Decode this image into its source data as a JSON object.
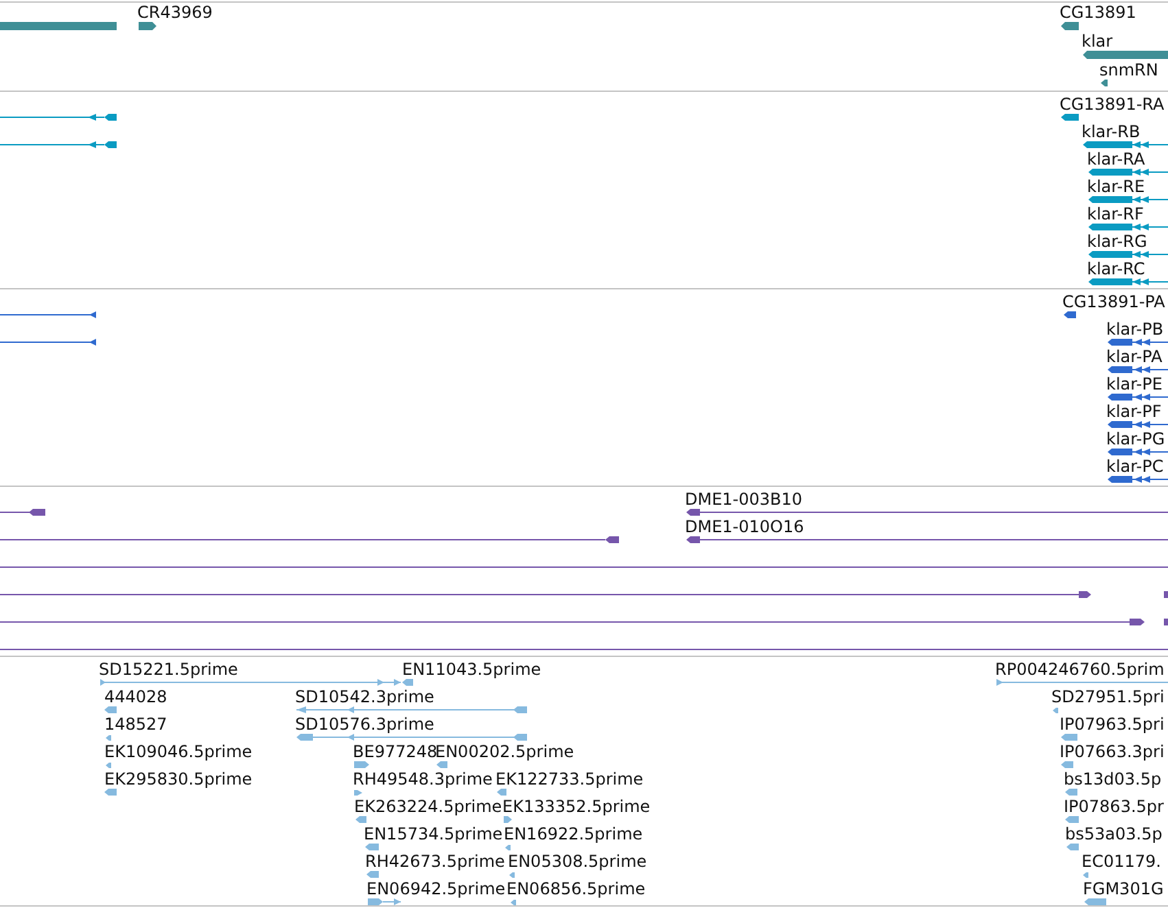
{
  "tracks": [
    {
      "color": "#3f8f96",
      "features": [
        {
          "kind": "block"
        },
        {
          "kind": "block",
          "label": "CR43969",
          "reverse": false
        },
        {
          "kind": "block",
          "label": "CG13891",
          "reverse": true
        },
        {
          "kind": "block",
          "label": "klar",
          "reverse": true
        },
        {
          "kind": "block",
          "label": "snmRN",
          "reverse": true
        }
      ]
    },
    {
      "color": "#0a9bc2",
      "features": [
        {
          "kind": "gapped",
          "reverse": true
        },
        {
          "kind": "block",
          "label": "CG13891-RA",
          "reverse": true
        },
        {
          "kind": "gapped",
          "reverse": true
        },
        {
          "kind": "gapped",
          "label": "klar-RB",
          "reverse": true
        },
        {
          "kind": "gapped",
          "label": "klar-RA",
          "reverse": true
        },
        {
          "kind": "gapped",
          "label": "klar-RE",
          "reverse": true
        },
        {
          "kind": "gapped",
          "label": "klar-RF",
          "reverse": true
        },
        {
          "kind": "gapped",
          "label": "klar-RG",
          "reverse": true
        },
        {
          "kind": "gapped",
          "label": "klar-RC",
          "reverse": true
        }
      ]
    },
    {
      "color": "#2f6acf",
      "features": [
        {
          "kind": "span",
          "reverse": true
        },
        {
          "kind": "block",
          "label": "CG13891-PA",
          "reverse": true
        },
        {
          "kind": "span",
          "reverse": true
        },
        {
          "kind": "gapped",
          "label": "klar-PB",
          "reverse": true
        },
        {
          "kind": "gapped",
          "label": "klar-PA",
          "reverse": true
        },
        {
          "kind": "gapped",
          "label": "klar-PE",
          "reverse": true
        },
        {
          "kind": "gapped",
          "label": "klar-PF",
          "reverse": true
        },
        {
          "kind": "gapped",
          "label": "klar-PG",
          "reverse": true
        },
        {
          "kind": "gapped",
          "label": "klar-PC",
          "reverse": true
        }
      ]
    },
    {
      "color": "#7656ab",
      "features": [
        {
          "kind": "gapped",
          "reverse": true
        },
        {
          "kind": "gapped",
          "label": "DME1-003B10",
          "reverse": true
        },
        {
          "kind": "gapped",
          "reverse": true
        },
        {
          "kind": "gapped",
          "label": "DME1-010O16",
          "reverse": true
        },
        {
          "kind": "span"
        },
        {
          "kind": "gapped",
          "reverse": false
        },
        {
          "kind": "block"
        },
        {
          "kind": "gapped",
          "reverse": false
        },
        {
          "kind": "block"
        },
        {
          "kind": "span"
        }
      ]
    },
    {
      "color": "#86badf",
      "features": [
        {
          "kind": "span",
          "label": "SD15221.5prime",
          "reverse": false
        },
        {
          "kind": "block",
          "label": "EN11043.5prime",
          "reverse": true
        },
        {
          "kind": "span",
          "label": "RP004246760.5prim",
          "reverse": false
        },
        {
          "kind": "block",
          "label": "444028",
          "reverse": true
        },
        {
          "kind": "gapped",
          "label": "SD10542.3prime",
          "reverse": true
        },
        {
          "kind": "block",
          "label": "SD27951.5pri",
          "reverse": true
        },
        {
          "kind": "block",
          "label": "148527",
          "reverse": true
        },
        {
          "kind": "gapped",
          "label": "SD10576.3prime",
          "reverse": true
        },
        {
          "kind": "block",
          "label": "IP07963.5pri",
          "reverse": true
        },
        {
          "kind": "block",
          "label": "EK109046.5prime",
          "reverse": true
        },
        {
          "kind": "block",
          "label": "BE977248",
          "reverse": false
        },
        {
          "kind": "block",
          "label": "EN00202.5prime",
          "reverse": true
        },
        {
          "kind": "block",
          "label": "IP07663.3pri",
          "reverse": true
        },
        {
          "kind": "block",
          "label": "EK295830.5prime",
          "reverse": true
        },
        {
          "kind": "block",
          "label": "RH49548.3prime",
          "reverse": false
        },
        {
          "kind": "block",
          "label": "EK122733.5prime",
          "reverse": true
        },
        {
          "kind": "block",
          "label": "bs13d03.5p",
          "reverse": true
        },
        {
          "kind": "block",
          "label": "EK263224.5prime",
          "reverse": true
        },
        {
          "kind": "block",
          "label": "EK133352.5prime",
          "reverse": false
        },
        {
          "kind": "block",
          "label": "IP07863.5pr",
          "reverse": true
        },
        {
          "kind": "block",
          "label": "EN15734.5prime",
          "reverse": true
        },
        {
          "kind": "block",
          "label": "EN16922.5prime",
          "reverse": true
        },
        {
          "kind": "block",
          "label": "bs53a03.5p",
          "reverse": true
        },
        {
          "kind": "block",
          "label": "RH42673.5prime",
          "reverse": true
        },
        {
          "kind": "block",
          "label": "EN05308.5prime",
          "reverse": true
        },
        {
          "kind": "block",
          "label": "EC01179.",
          "reverse": true
        },
        {
          "kind": "gapped",
          "label": "EN06942.5prime",
          "reverse": false
        },
        {
          "kind": "block",
          "label": "EN06856.5prime",
          "reverse": true
        },
        {
          "kind": "block",
          "label": "FGM301G",
          "reverse": true
        }
      ]
    }
  ]
}
